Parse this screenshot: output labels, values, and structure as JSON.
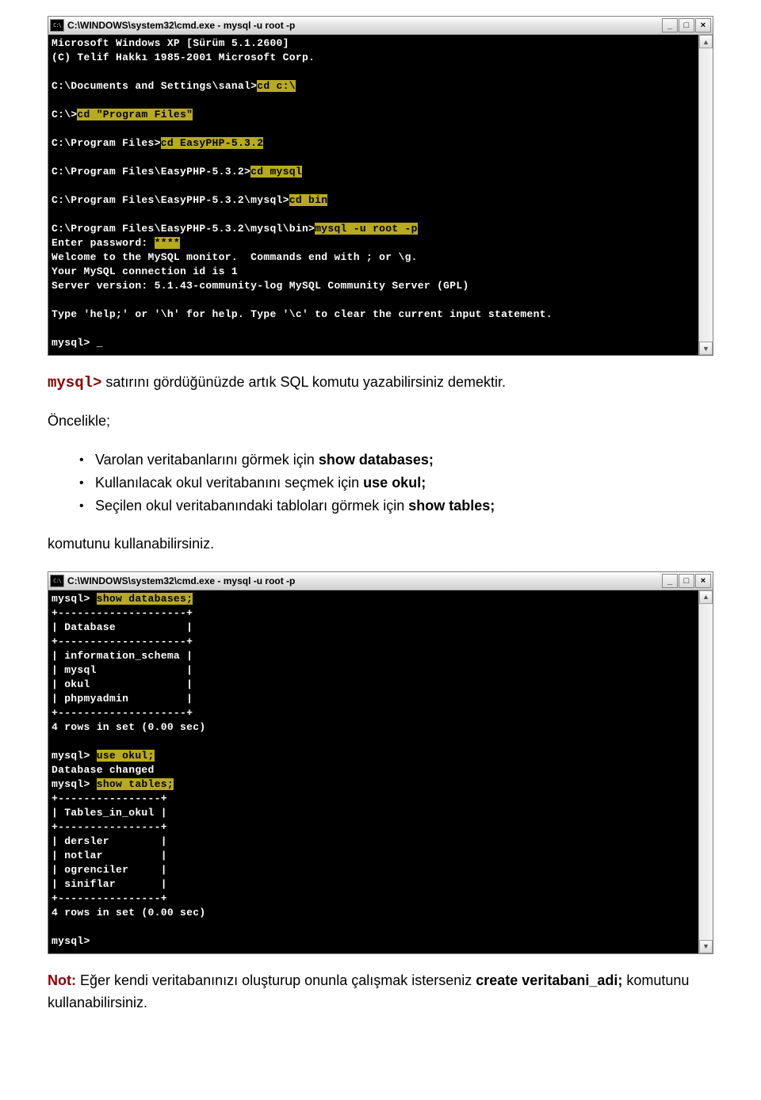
{
  "win1": {
    "icon_text": "C:\\",
    "title": "C:\\WINDOWS\\system32\\cmd.exe - mysql -u root -p",
    "btn_min": "_",
    "btn_max": "□",
    "btn_close": "×",
    "sb_up": "▲",
    "sb_down": "▼",
    "l1": "Microsoft Windows XP [Sürüm 5.1.2600]",
    "l2": "(C) Telif Hakkı 1985-2001 Microsoft Corp.",
    "p1a": "C:\\Documents and Settings\\sanal>",
    "p1b": "cd c:\\",
    "p2a": "C:\\>",
    "p2b": "cd \"Program Files\"",
    "p3a": "C:\\Program Files>",
    "p3b": "cd EasyPHP-5.3.2",
    "p4a": "C:\\Program Files\\EasyPHP-5.3.2>",
    "p4b": "cd mysql",
    "p5a": "C:\\Program Files\\EasyPHP-5.3.2\\mysql>",
    "p5b": "cd bin",
    "p6a": "C:\\Program Files\\EasyPHP-5.3.2\\mysql\\bin>",
    "p6b": "mysql -u root -p",
    "l7a": "Enter password: ",
    "l7b": "****",
    "l8": "Welcome to the MySQL monitor.  Commands end with ; or \\g.",
    "l9": "Your MySQL connection id is 1",
    "l10": "Server version: 5.1.43-community-log MySQL Community Server (GPL)",
    "l11": "Type 'help;' or '\\h' for help. Type '\\c' to clear the current input statement.",
    "l12": "mysql> _"
  },
  "txt": {
    "prompt": "mysql>",
    "p1_rest": " satırını gördüğünüzde artık SQL komutu yazabilirsiniz demektir.",
    "p2": "Öncelikle;",
    "b1a": "Varolan veritabanlarını görmek için ",
    "b1b": "show databases;",
    "b2a": "Kullanılacak okul veritabanını seçmek için ",
    "b2b": "use okul;",
    "b3a": "Seçilen okul veritabanındaki tabloları görmek için ",
    "b3b": "show tables;",
    "p3": "komutunu kullanabilirsiniz.",
    "note_label": "Not:",
    "note_a": " Eğer kendi veritabanınızı oluşturup onunla çalışmak isterseniz ",
    "note_cmd": "create veritabani_adi;",
    "note_b": " komutunu kullanabilirsiniz."
  },
  "win2": {
    "icon_text": "C:\\",
    "title": "C:\\WINDOWS\\system32\\cmd.exe - mysql -u root -p",
    "btn_min": "_",
    "btn_max": "□",
    "btn_close": "×",
    "sb_up": "▲",
    "sb_down": "▼",
    "r1a": "mysql> ",
    "r1b": "show databases;",
    "d_sep": "+--------------------+",
    "d_hdr": "| Database           |",
    "d_r1": "| information_schema |",
    "d_r2": "| mysql              |",
    "d_r3": "| okul               |",
    "d_r4": "| phpmyadmin         |",
    "d_cnt": "4 rows in set (0.00 sec)",
    "r2a": "mysql> ",
    "r2b": "use okul;",
    "r2c": "Database changed",
    "r3a": "mysql> ",
    "r3b": "show tables;",
    "t_sep": "+----------------+",
    "t_hdr": "| Tables_in_okul |",
    "t_r1": "| dersler        |",
    "t_r2": "| notlar         |",
    "t_r3": "| ogrenciler     |",
    "t_r4": "| siniflar       |",
    "t_cnt": "4 rows in set (0.00 sec)",
    "r4": "mysql>"
  }
}
